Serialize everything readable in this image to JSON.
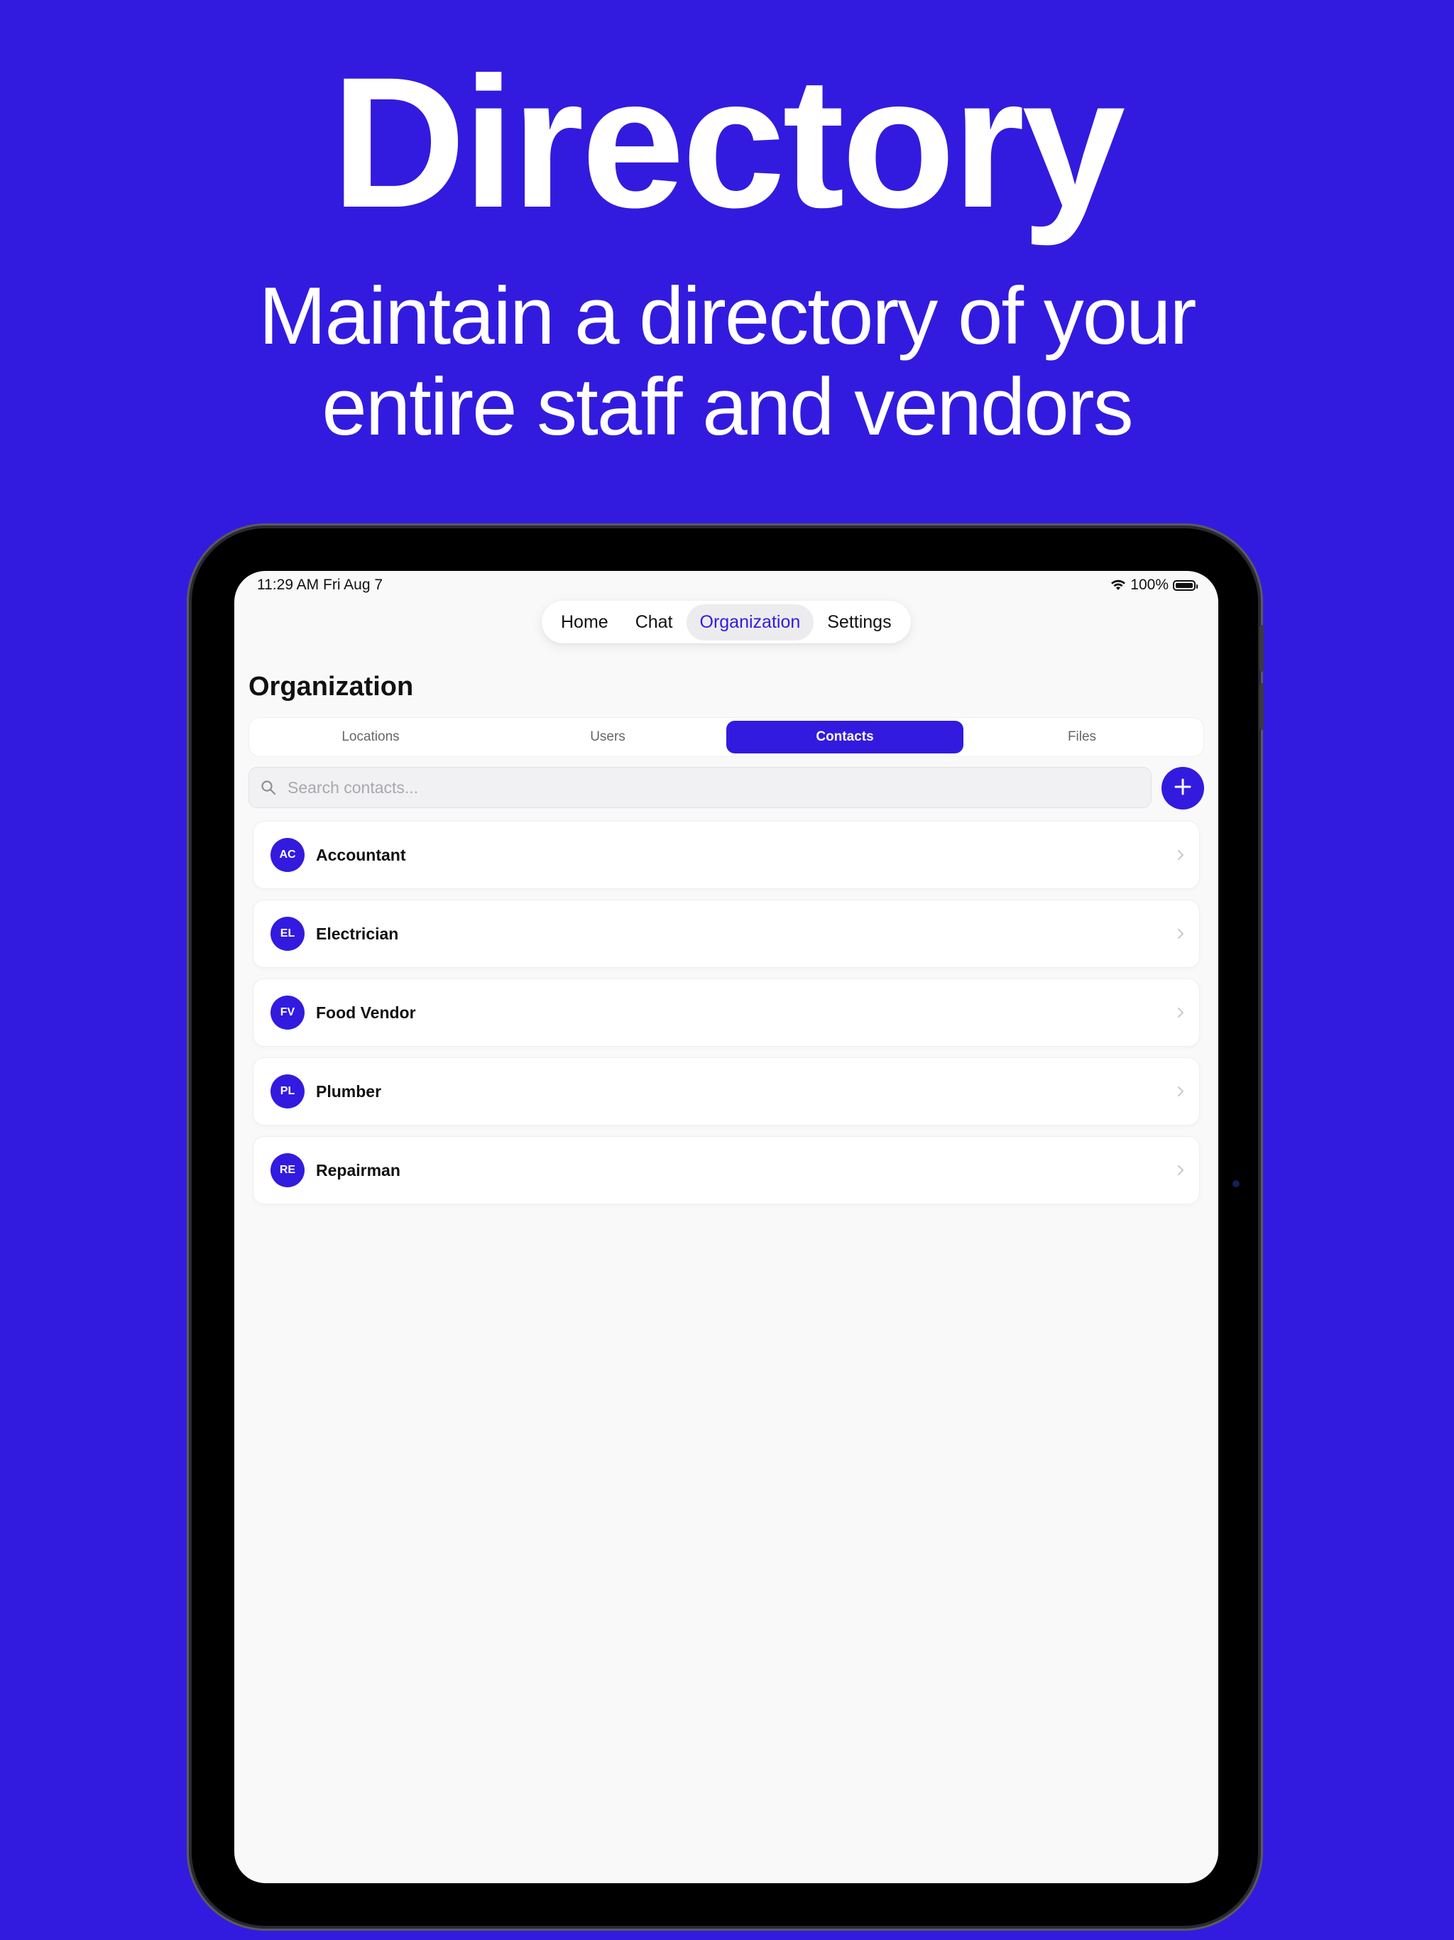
{
  "hero": {
    "title": "Directory",
    "subtitle_line1": "Maintain a directory of your",
    "subtitle_line2": "entire staff and vendors"
  },
  "status_bar": {
    "time": "11:29 AM",
    "date": "Fri Aug 7",
    "battery": "100%",
    "wifi_icon": "wifi-icon",
    "battery_icon": "battery-icon"
  },
  "top_nav": {
    "items": [
      "Home",
      "Chat",
      "Organization",
      "Settings"
    ],
    "active": "Organization"
  },
  "page": {
    "title": "Organization"
  },
  "segments": {
    "items": [
      "Locations",
      "Users",
      "Contacts",
      "Files"
    ],
    "active": "Contacts"
  },
  "search": {
    "placeholder": "Search contacts...",
    "value": "",
    "icon": "search-icon"
  },
  "add_button": {
    "icon": "plus-icon"
  },
  "contacts": [
    {
      "initials": "AC",
      "name": "Accountant"
    },
    {
      "initials": "EL",
      "name": "Electrician"
    },
    {
      "initials": "FV",
      "name": "Food Vendor"
    },
    {
      "initials": "PL",
      "name": "Plumber"
    },
    {
      "initials": "RE",
      "name": "Repairman"
    }
  ],
  "colors": {
    "brand": "#321BDF",
    "background": "#321BDF",
    "screen": "#F9F9F9",
    "card": "#FFFFFF"
  }
}
